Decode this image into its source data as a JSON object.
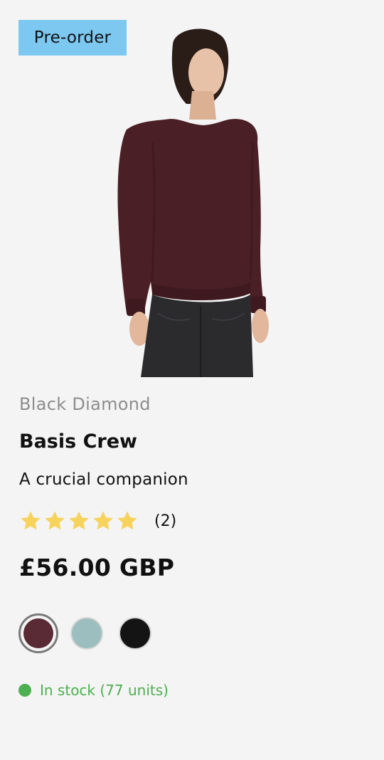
{
  "badge": {
    "label": "Pre-order",
    "color": "#7cc8f0"
  },
  "product": {
    "image_alt": "Woman wearing a dark burgundy long-sleeve crew sweater",
    "brand": "Black Diamond",
    "title": "Basis Crew",
    "subtitle": "A crucial companion",
    "rating": {
      "stars": 5,
      "max_stars": 5,
      "review_count": "(2)",
      "star_color": "#f7d35c"
    },
    "price": "£56.00 GBP"
  },
  "swatches": [
    {
      "name": "burgundy",
      "color": "#5a2a35",
      "selected": true
    },
    {
      "name": "sage",
      "color": "#9dbebe",
      "selected": false
    },
    {
      "name": "black",
      "color": "#141414",
      "selected": false
    }
  ],
  "stock": {
    "label": "In stock (77 units)",
    "color": "#4caf50"
  }
}
